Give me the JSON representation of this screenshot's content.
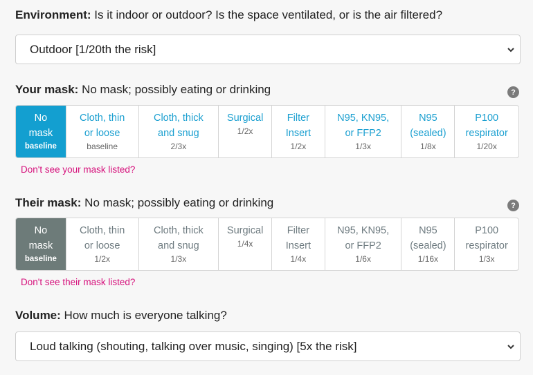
{
  "environment": {
    "label": "Environment:",
    "question": "Is it indoor or outdoor? Is the space ventilated, or is the air filtered?",
    "selected": "Outdoor [1/20th the risk]"
  },
  "your_mask": {
    "label": "Your mask:",
    "current": "No mask; possibly eating or drinking",
    "help": "?",
    "link": "Don't see your mask listed?",
    "options": [
      {
        "name": "No\nmask",
        "factor": "baseline",
        "active": true
      },
      {
        "name": "Cloth, thin\nor loose",
        "factor": "baseline"
      },
      {
        "name": "Cloth, thick\nand snug",
        "factor": "2/3x"
      },
      {
        "name": "Surgical",
        "factor": "1/2x"
      },
      {
        "name": "Filter\nInsert",
        "factor": "1/2x"
      },
      {
        "name": "N95, KN95,\nor FFP2",
        "factor": "1/3x"
      },
      {
        "name": "N95\n(sealed)",
        "factor": "1/8x"
      },
      {
        "name": "P100\nrespirator",
        "factor": "1/20x"
      }
    ]
  },
  "their_mask": {
    "label": "Their mask:",
    "current": "No mask; possibly eating or drinking",
    "help": "?",
    "link": "Don't see their mask listed?",
    "options": [
      {
        "name": "No\nmask",
        "factor": "baseline",
        "active": true
      },
      {
        "name": "Cloth, thin\nor loose",
        "factor": "1/2x"
      },
      {
        "name": "Cloth, thick\nand snug",
        "factor": "1/3x"
      },
      {
        "name": "Surgical",
        "factor": "1/4x"
      },
      {
        "name": "Filter\nInsert",
        "factor": "1/4x"
      },
      {
        "name": "N95, KN95,\nor FFP2",
        "factor": "1/6x"
      },
      {
        "name": "N95\n(sealed)",
        "factor": "1/16x"
      },
      {
        "name": "P100\nrespirator",
        "factor": "1/3x"
      }
    ]
  },
  "volume": {
    "label": "Volume:",
    "question": "How much is everyone talking?",
    "selected": "Loud talking (shouting, talking over music, singing) [5x the risk]"
  }
}
